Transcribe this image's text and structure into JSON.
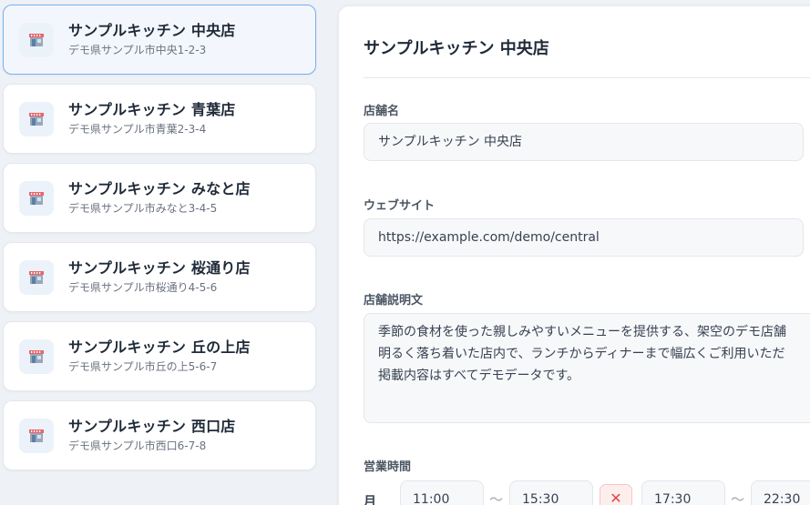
{
  "stores": [
    {
      "name": "サンプルキッチン 中央店",
      "address": "デモ県サンプル市中央1-2-3",
      "selected": true
    },
    {
      "name": "サンプルキッチン 青葉店",
      "address": "デモ県サンプル市青葉2-3-4",
      "selected": false
    },
    {
      "name": "サンプルキッチン みなと店",
      "address": "デモ県サンプル市みなと3-4-5",
      "selected": false
    },
    {
      "name": "サンプルキッチン 桜通り店",
      "address": "デモ県サンプル市桜通り4-5-6",
      "selected": false
    },
    {
      "name": "サンプルキッチン 丘の上店",
      "address": "デモ県サンプル市丘の上5-6-7",
      "selected": false
    },
    {
      "name": "サンプルキッチン 西口店",
      "address": "デモ県サンプル市西口6-7-8",
      "selected": false
    }
  ],
  "store_icon": "storefront-icon",
  "detail": {
    "title": "サンプルキッチン 中央店",
    "store_name_label": "店舗名",
    "store_name_value": "サンプルキッチン 中央店",
    "website_label": "ウェブサイト",
    "website_value": "https://example.com/demo/central",
    "description_label": "店舗説明文",
    "description_lines": [
      "季節の食材を使った親しみやすいメニューを提供する、架空のデモ店舗",
      "明るく落ち着いた店内で、ランチからディナーまで幅広くご利用いただ",
      "掲載内容はすべてデモデータです。"
    ],
    "hours_label": "営業時間",
    "hours": {
      "day": "月",
      "open1": "11:00",
      "close1": "15:30",
      "open2": "17:30",
      "close2": "22:30",
      "separator": "〜",
      "remove_icon": "close-icon"
    }
  },
  "colors": {
    "selected_border": "#76aef5",
    "remove_button": "#e24848",
    "background": "#eef1f5"
  }
}
